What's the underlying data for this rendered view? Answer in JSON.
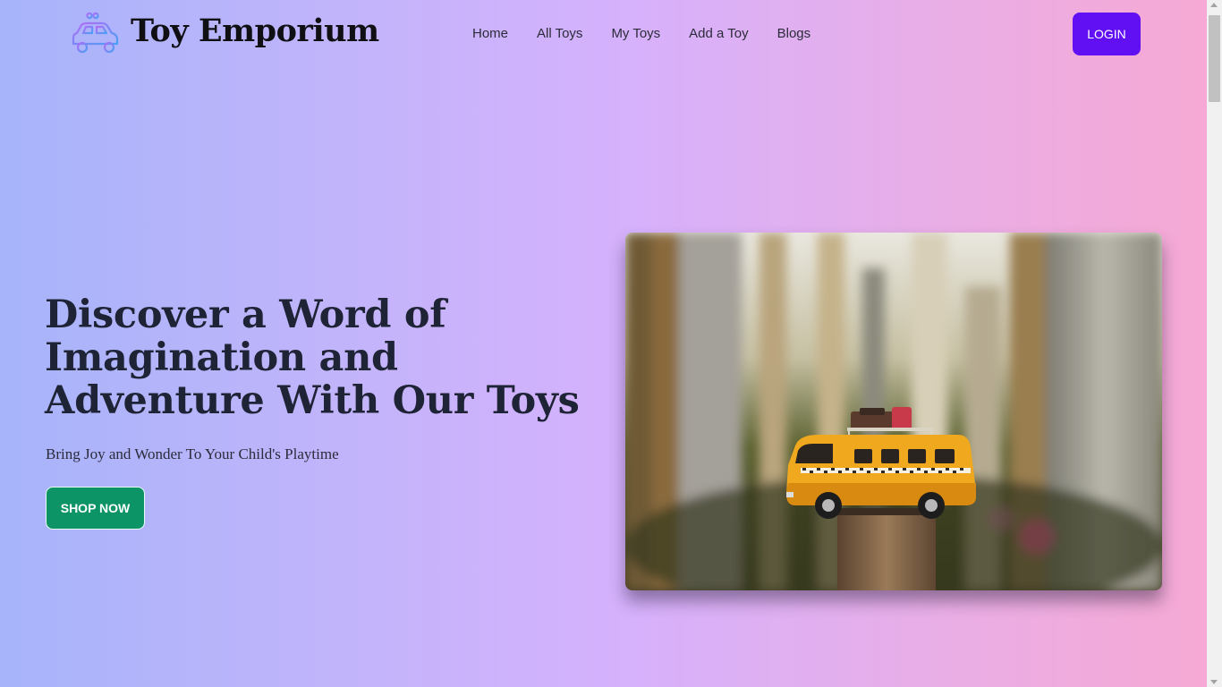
{
  "header": {
    "brand": "Toy Emporium",
    "logo_icon": "toy-car-icon",
    "nav": [
      "Home",
      "All Toys",
      "My Toys",
      "Add a Toy",
      "Blogs"
    ],
    "login_label": "LOGIN"
  },
  "hero": {
    "headline_lines": [
      "Discover a Word of",
      "Imagination and",
      "Adventure With Our Toys"
    ],
    "subtitle": "Bring Joy and Wonder To Your Child's Playtime",
    "cta_label": "SHOP NOW",
    "image_subject": "yellow toy van on wooden post"
  },
  "colors": {
    "accent": "#6110f4",
    "cta": "#0d9466",
    "heading": "#1f2336"
  }
}
